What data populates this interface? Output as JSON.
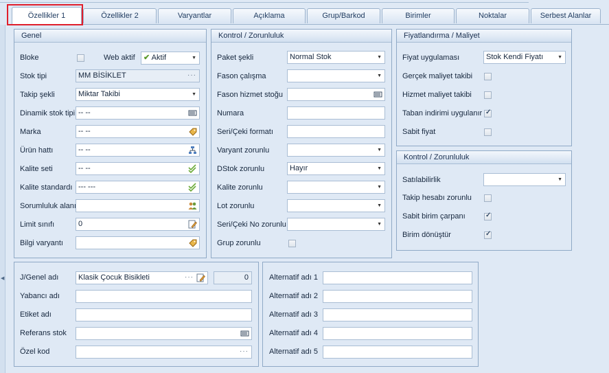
{
  "tabs": [
    "Özellikler 1",
    "Özellikler 2",
    "Varyantlar",
    "Açıklama",
    "Grup/Barkod",
    "Birimler",
    "Noktalar",
    "Serbest Alanlar"
  ],
  "genel": {
    "title": "Genel",
    "bloke_label": "Bloke",
    "web_aktif_label": "Web aktif",
    "web_aktif_value": "Aktif",
    "stok_tipi_label": "Stok tipi",
    "stok_tipi_value": "MM BİSİKLET",
    "takip_sekli_label": "Takip şekli",
    "takip_sekli_value": "Miktar Takibi",
    "dinamik_stok_tipi_label": "Dinamik stok tipi",
    "dinamik_stok_tipi_value": "-- --",
    "marka_label": "Marka",
    "marka_value": "-- --",
    "urun_hatti_label": "Ürün hattı",
    "urun_hatti_value": "-- --",
    "kalite_seti_label": "Kalite seti",
    "kalite_seti_value": "-- --",
    "kalite_standardi_label": "Kalite standardı",
    "kalite_standardi_value": "--- ---",
    "sorumluluk_alani_label": "Sorumluluk alanı",
    "limit_sinifi_label": "Limit sınıfı",
    "limit_sinifi_value": "0",
    "bilgi_varyanti_label": "Bilgi varyantı"
  },
  "kontrol1": {
    "title": "Kontrol / Zorunluluk",
    "paket_sekli_label": "Paket şekli",
    "paket_sekli_value": "Normal Stok",
    "fason_calisma_label": "Fason çalışma",
    "fason_hizmet_label": "Fason hizmet stoğu",
    "numara_label": "Numara",
    "seri_ceki_formati_label": "Seri/Çeki formatı",
    "varyant_zorunlu_label": "Varyant zorunlu",
    "dstok_zorunlu_label": "DStok zorunlu",
    "dstok_zorunlu_value": "Hayır",
    "kalite_zorunlu_label": "Kalite zorunlu",
    "lot_zorunlu_label": "Lot zorunlu",
    "seri_ceki_no_zorunlu_label": "Seri/Çeki No zorunlu",
    "grup_zorunlu_label": "Grup zorunlu"
  },
  "fiyat": {
    "title": "Fiyatlandırma / Maliyet",
    "fiyat_uygulamasi_label": "Fiyat uygulaması",
    "fiyat_uygulamasi_value": "Stok Kendi Fiyatı",
    "gercek_maliyet_label": "Gerçek maliyet takibi",
    "hizmet_maliyet_label": "Hizmet maliyet takibi",
    "taban_indirimi_label": "Taban indirimi uygulanır",
    "sabit_fiyat_label": "Sabit fiyat"
  },
  "kontrol2": {
    "title": "Kontrol / Zorunluluk",
    "satilabilirlik_label": "Satılabilirlik",
    "takip_hesabi_label": "Takip hesabı zorunlu",
    "sabit_birim_label": "Sabit birim çarpanı",
    "birim_donustur_label": "Birim dönüştür"
  },
  "names": {
    "genel_adi_label": "J/Genel adı",
    "genel_adi_value": "Klasik Çocuk Bisikleti",
    "genel_adi_count": "0",
    "yabanci_adi_label": "Yabancı adı",
    "etiket_adi_label": "Etiket adı",
    "referans_stok_label": "Referans stok",
    "ozel_kod_label": "Özel kod"
  },
  "alternatif": {
    "labels": [
      "Alternatif adı 1",
      "Alternatif adı 2",
      "Alternatif adı 3",
      "Alternatif adı 4",
      "Alternatif adı 5"
    ]
  }
}
